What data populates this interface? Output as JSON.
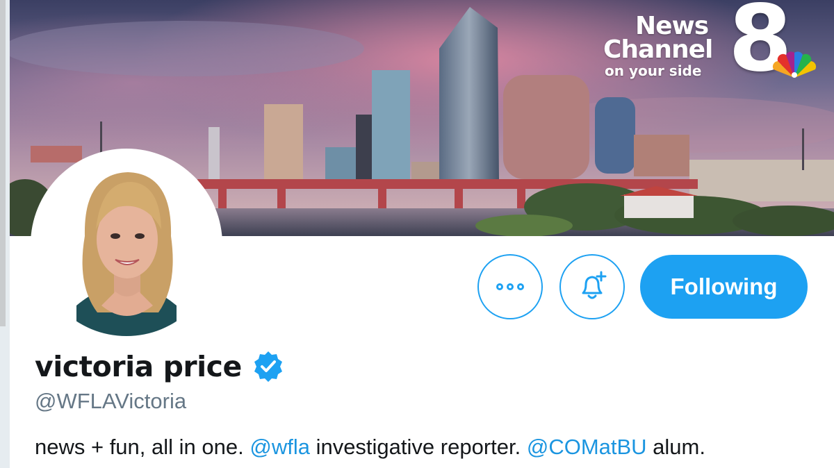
{
  "banner": {
    "logo": {
      "line1": "News",
      "line2": "Channel",
      "tagline": "on your side",
      "number": "8"
    }
  },
  "profile": {
    "display_name": "victoria price",
    "handle": "@WFLAVictoria",
    "verified": true,
    "bio": {
      "part1": "news + fun, all in one. ",
      "mention1": "@wfla",
      "part2": " investigative reporter. ",
      "mention2": "@COMatBU",
      "part3": " alum."
    }
  },
  "actions": {
    "more_icon": "more-dots-icon",
    "notify_icon": "bell-plus-icon",
    "follow_label": "Following"
  },
  "colors": {
    "accent": "#1da1f2",
    "mention": "#1b95e0",
    "handle_gray": "#657786",
    "text": "#14171a"
  }
}
